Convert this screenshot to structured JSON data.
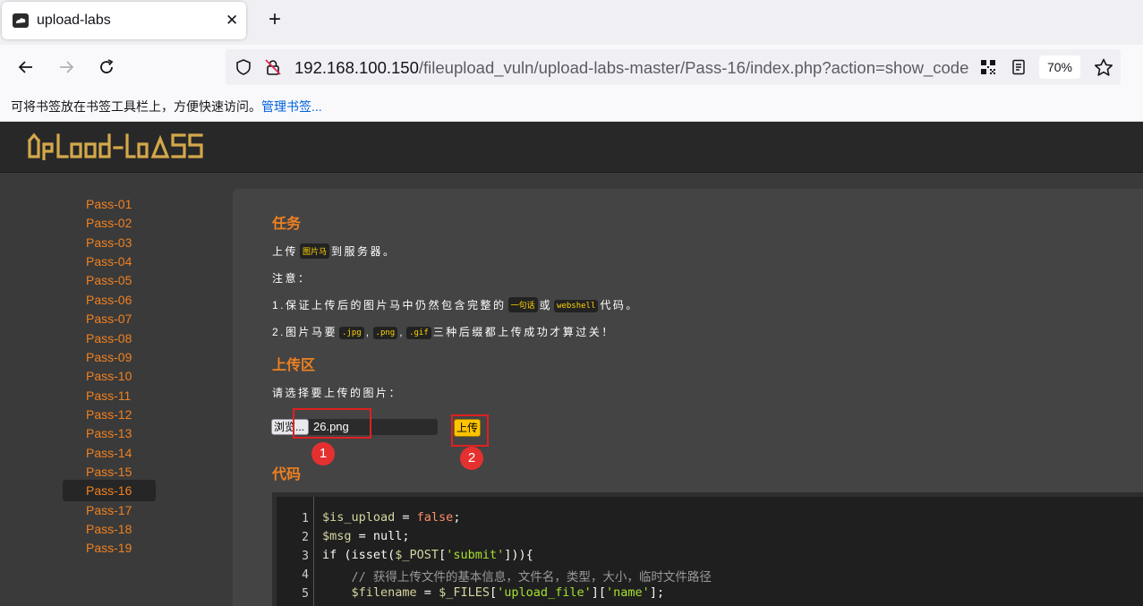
{
  "browser": {
    "tab_title": "upload-labs",
    "close_glyph": "✕",
    "newtab_glyph": "+",
    "url_host": "192.168.100.150",
    "url_path": "/fileupload_vuln/upload-labs-master/Pass-16/index.php?action=show_code",
    "zoom": "70%",
    "bookmark_hint": "可将书签放在书签工具栏上，方便快速访问。",
    "bookmark_link": "管理书签..."
  },
  "site": {
    "logo_text": "UpLoad-labs"
  },
  "sidebar": {
    "items": [
      "Pass-01",
      "Pass-02",
      "Pass-03",
      "Pass-04",
      "Pass-05",
      "Pass-06",
      "Pass-07",
      "Pass-08",
      "Pass-09",
      "Pass-10",
      "Pass-11",
      "Pass-12",
      "Pass-13",
      "Pass-14",
      "Pass-15",
      "Pass-16",
      "Pass-17",
      "Pass-18",
      "Pass-19"
    ],
    "active_index": 15
  },
  "task": {
    "title": "任务",
    "line1_a": "上传",
    "line1_chip": "图片马",
    "line1_b": "到服务器。",
    "note": "注意：",
    "line3_a": "1.保证上传后的图片马中仍然包含完整的",
    "line3_chip1": "一句话",
    "line3_mid": "或",
    "line3_chip2": "webshell",
    "line3_b": "代码。",
    "line4_a": "2.图片马要",
    "line4_chip1": ".jpg",
    "line4_sep1": ",",
    "line4_chip2": ".png",
    "line4_sep2": ",",
    "line4_chip3": ".gif",
    "line4_b": "三种后缀都上传成功才算过关！"
  },
  "upload": {
    "title": "上传区",
    "prompt": "请选择要上传的图片：",
    "browse_label": "浏览...",
    "file_name": "26.png",
    "submit_label": "上传",
    "annotation_1": "1",
    "annotation_2": "2"
  },
  "code": {
    "title": "代码",
    "line_numbers": [
      "1",
      "2",
      "3",
      "4",
      "5"
    ],
    "l1_var": "$is_upload",
    "l1_op": " = ",
    "l1_val": "false",
    "l1_end": ";",
    "l2_var": "$msg",
    "l2_op": " = ",
    "l2_val": "null",
    "l2_end": ";",
    "l3_kw": "if",
    "l3_a": " (isset(",
    "l3_var": "$_POST",
    "l3_b": "[",
    "l3_str": "'submit'",
    "l3_c": "])){",
    "l4_cmt": "    // 获得上传文件的基本信息，文件名，类型，大小，临时文件路径",
    "l5_indent": "    ",
    "l5_var": "$filename",
    "l5_op": " = ",
    "l5_var2": "$_FILES",
    "l5_a": "[",
    "l5_str1": "'upload_file'",
    "l5_b": "][",
    "l5_str2": "'name'",
    "l5_c": "];"
  },
  "colors": {
    "accent": "#f08020",
    "button": "#ffc400",
    "annotation": "#e53030"
  }
}
